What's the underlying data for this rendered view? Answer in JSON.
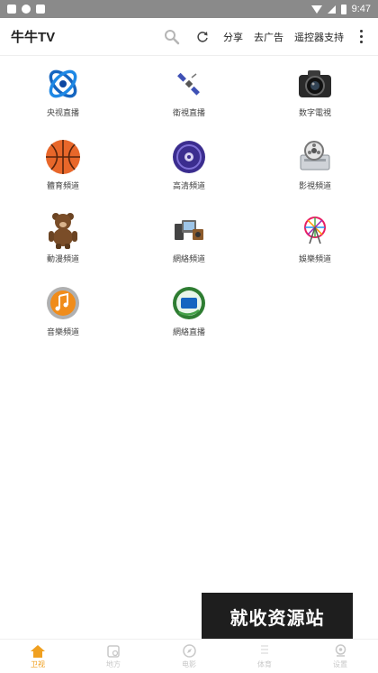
{
  "status_bar": {
    "time": "9:47"
  },
  "toolbar": {
    "title": "牛牛TV",
    "share_label": "分享",
    "remove_ads_label": "去广告",
    "remote_label": "遥控器支持"
  },
  "channels": [
    {
      "label": "央视直播",
      "icon": "cctv-logo-icon"
    },
    {
      "label": "衛視直播",
      "icon": "satellite-icon"
    },
    {
      "label": "数字電視",
      "icon": "camera-icon"
    },
    {
      "label": "體育頻道",
      "icon": "basketball-icon"
    },
    {
      "label": "高清頻道",
      "icon": "disc-icon"
    },
    {
      "label": "影視頻道",
      "icon": "film-reel-icon"
    },
    {
      "label": "動漫頻道",
      "icon": "cartoon-bear-icon"
    },
    {
      "label": "網絡頻道",
      "icon": "media-devices-icon"
    },
    {
      "label": "娛樂頻道",
      "icon": "ferris-wheel-icon"
    },
    {
      "label": "音樂頻道",
      "icon": "music-disc-icon"
    },
    {
      "label": "網絡直播",
      "icon": "live-tv-icon"
    }
  ],
  "watermark": {
    "text": "就收资源站"
  },
  "bottom_nav": {
    "items": [
      {
        "label": "卫视",
        "icon": "home-icon",
        "active": true
      },
      {
        "label": "地方",
        "icon": "local-icon",
        "active": false
      },
      {
        "label": "电影",
        "icon": "compass-icon",
        "active": false
      },
      {
        "label": "体育",
        "icon": "sport-icon",
        "active": false
      },
      {
        "label": "设置",
        "icon": "settings-icon",
        "active": false
      }
    ]
  },
  "colors": {
    "accent": "#f0a020",
    "status_bar": "#8a8a8a"
  }
}
